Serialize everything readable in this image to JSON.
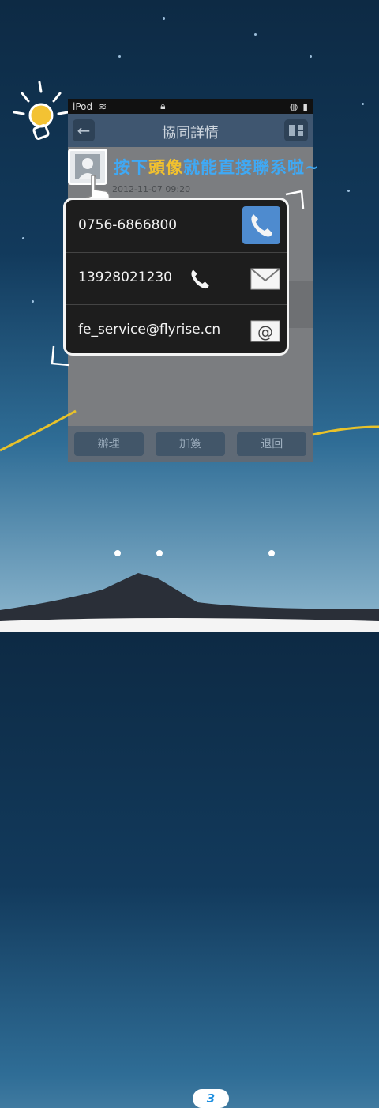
{
  "status_bar": {
    "carrier": "iPod"
  },
  "header": {
    "title": "協同詳情"
  },
  "document": {
    "date": "2012-11-07 09:20"
  },
  "popup": {
    "office_phone": "0756-6866800",
    "mobile_phone": "13928021230",
    "email": "fe_service@flyrise.cn"
  },
  "caption": {
    "part1": "按下",
    "part2": "頭像",
    "part3": "就能直接聯系啦~"
  },
  "bottom_bar": {
    "handle": "辦理",
    "add_sign": "加簽",
    "return": "退回"
  },
  "pager": {
    "current": "3"
  },
  "colors": {
    "accent_blue": "#4e8bcf",
    "caption_blue": "#3fa9f5",
    "caption_yellow": "#f2c12e"
  }
}
